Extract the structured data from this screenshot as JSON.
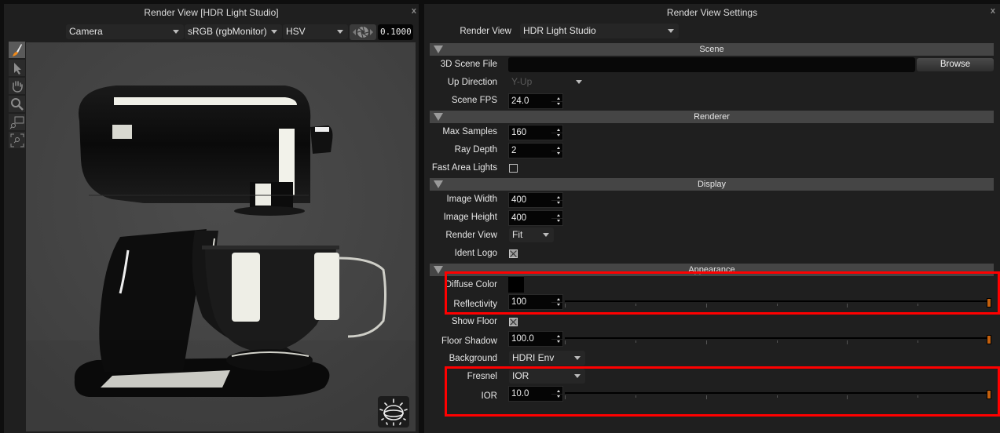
{
  "render_view": {
    "title": "Render View [HDR Light Studio]",
    "close": "x",
    "camera_select": "Camera",
    "colorspace_select": "sRGB (rgbMonitor)",
    "color_mode_select": "HSV",
    "exposure_value": "0.1000",
    "tools": [
      {
        "name": "paint-brush",
        "active": true
      },
      {
        "name": "select-arrow",
        "active": false
      },
      {
        "name": "pan-hand",
        "active": false
      },
      {
        "name": "zoom",
        "active": false
      },
      {
        "name": "zoom-region",
        "active": false
      },
      {
        "name": "zoom-fit",
        "active": false
      }
    ],
    "render_subject": "stand mixer"
  },
  "settings": {
    "title": "Render View Settings",
    "close": "x",
    "render_view_label": "Render View",
    "render_view_value": "HDR Light Studio",
    "sections": {
      "scene": {
        "header": "Scene",
        "scene_file_label": "3D Scene File",
        "scene_file_value": "",
        "browse_label": "Browse",
        "up_direction_label": "Up Direction",
        "up_direction_value": "Y-Up",
        "fps_label": "Scene FPS",
        "fps_value": "24.0"
      },
      "renderer": {
        "header": "Renderer",
        "max_samples_label": "Max Samples",
        "max_samples_value": "160",
        "ray_depth_label": "Ray Depth",
        "ray_depth_value": "2",
        "fast_area_lights_label": "Fast Area Lights",
        "fast_area_lights_checked": false
      },
      "display": {
        "header": "Display",
        "image_width_label": "Image Width",
        "image_width_value": "400",
        "image_height_label": "Image Height",
        "image_height_value": "400",
        "render_view_label": "Render View",
        "render_view_value": "Fit",
        "ident_logo_label": "Ident Logo",
        "ident_logo_checked": true
      },
      "appearance": {
        "header": "Appearance",
        "diffuse_color_label": "Diffuse Color",
        "diffuse_color": "#000000",
        "reflectivity_label": "Reflectivity",
        "reflectivity_value": "100",
        "reflectivity_slider_fraction": 1.0,
        "show_floor_label": "Show Floor",
        "show_floor_checked": true,
        "floor_shadow_label": "Floor Shadow",
        "floor_shadow_value": "100.0",
        "floor_shadow_slider_fraction": 1.0,
        "background_label": "Background",
        "background_value": "HDRI Env",
        "fresnel_label": "Fresnel",
        "fresnel_value": "IOR",
        "ior_label": "IOR",
        "ior_value": "10.0",
        "ior_slider_fraction": 1.0
      }
    }
  },
  "colors": {
    "slider_handle": "#c4600d",
    "highlight_box": "#ff0000",
    "panel_bg": "#1f1f1f",
    "section_header_bg": "#454545"
  }
}
